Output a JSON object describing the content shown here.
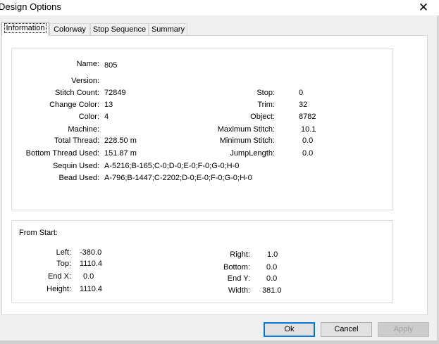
{
  "window": {
    "title": "Design Options",
    "close_glyph": "✕"
  },
  "tabs": [
    "Information",
    "Colorway",
    "Stop Sequence",
    "Summary"
  ],
  "info": {
    "name_label": "Name:",
    "name": "805",
    "version_label": "Version:",
    "version": "",
    "stitch_count_label": "Stitch Count:",
    "stitch_count": "72849",
    "change_color_label": "Change Color:",
    "change_color": "13",
    "color_label": "Color:",
    "color": "4",
    "machine_label": "Machine:",
    "machine": "",
    "total_thread_label": "Total Thread:",
    "total_thread": "228.50 m",
    "bottom_thread_label": "Bottom Thread Used:",
    "bottom_thread": "151.87 m",
    "sequin_label": "Sequin Used:",
    "sequin": "A-5216;B-165;C-0;D-0;E-0;F-0;G-0;H-0",
    "bead_label": "Bead Used:",
    "bead": "A-796;B-1447;C-2202;D-0;E-0;F-0;G-0;H-0",
    "stop_label": "Stop:",
    "stop": "0",
    "trim_label": "Trim:",
    "trim": "32",
    "object_label": "Object:",
    "object": "8782",
    "max_stitch_label": "Maximum Stitch:",
    "max_stitch": "10.1",
    "min_stitch_label": "Minimum Stitch:",
    "min_stitch": "0.0",
    "jump_length_label": "JumpLength:",
    "jump_length": "0.0"
  },
  "from_start": {
    "title": "From Start:",
    "left_label": "Left:",
    "left": "-380.0",
    "top_label": "Top:",
    "top": "1110.4",
    "endx_label": "End X:",
    "endx": "0.0",
    "height_label": "Height:",
    "height": "1110.4",
    "right_label": "Right:",
    "right": "1.0",
    "bottom_label": "Bottom:",
    "bottom": "0.0",
    "endy_label": "End Y:",
    "endy": "0.0",
    "width_label": "Width:",
    "width": "381.0"
  },
  "buttons": {
    "ok": "Ok",
    "cancel": "Cancel",
    "apply": "Apply"
  }
}
